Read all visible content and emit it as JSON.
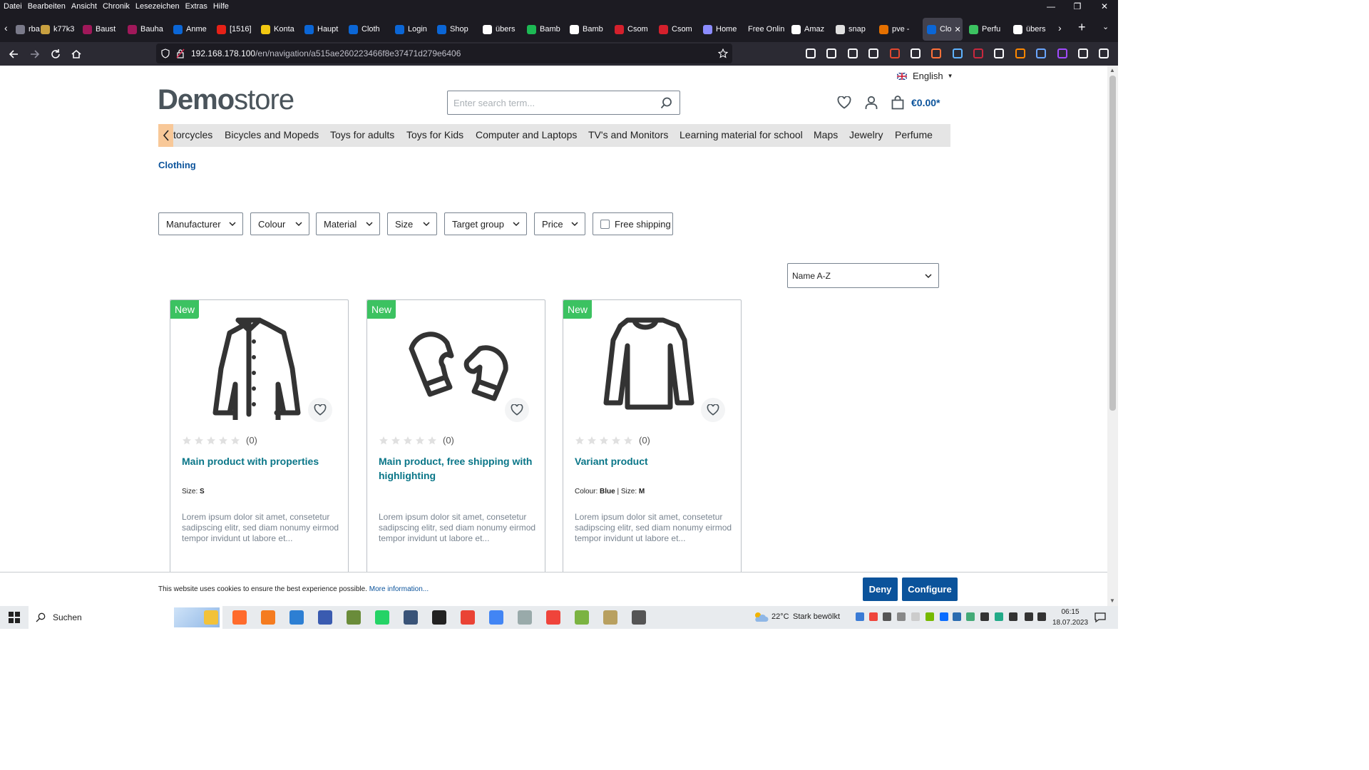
{
  "browser": {
    "menu": [
      "Datei",
      "Bearbeiten",
      "Ansicht",
      "Chronik",
      "Lesezeichen",
      "Extras",
      "Hilfe"
    ],
    "tabs": [
      {
        "label": "rba",
        "color": "#7a7a8a"
      },
      {
        "label": "k77k3",
        "color": "#c8a040"
      },
      {
        "label": "Baust",
        "color": "#a0185a"
      },
      {
        "label": "Bauha",
        "color": "#a0185a"
      },
      {
        "label": "Anme",
        "color": "#0b66d6"
      },
      {
        "label": "[1516]",
        "color": "#e62117"
      },
      {
        "label": "Konta",
        "color": "#f2c811"
      },
      {
        "label": "Haupt",
        "color": "#0b66d6"
      },
      {
        "label": "Cloth",
        "color": "#0b66d6"
      },
      {
        "label": "Login",
        "color": "#0b66d6"
      },
      {
        "label": "Shop",
        "color": "#0b66d6"
      },
      {
        "label": "übers",
        "color": "#ffffff"
      },
      {
        "label": "Bamb",
        "color": "#1db954"
      },
      {
        "label": "Bamb",
        "color": "#ffffff"
      },
      {
        "label": "Csom",
        "color": "#d4202c"
      },
      {
        "label": "Csom",
        "color": "#d4202c"
      },
      {
        "label": "Home",
        "color": "#8c8cff"
      },
      {
        "label": "Free Onlin",
        "color": ""
      },
      {
        "label": "Amaz",
        "color": "#ffffff"
      },
      {
        "label": "snap",
        "color": "#e0e0e0"
      },
      {
        "label": "pve -",
        "color": "#e57000"
      },
      {
        "label": "Clo",
        "color": "#0b66d6"
      },
      {
        "label": "Perfu",
        "color": "#3cc261"
      },
      {
        "label": "übers",
        "color": "#ffffff"
      }
    ],
    "url_host": "192.168.178.100",
    "url_path": "/en/navigation/a515ae260223466f8e37471d279e6406"
  },
  "header": {
    "language": "English",
    "logo_bold": "Demo",
    "logo_light": "store",
    "search_placeholder": "Enter search term...",
    "cart_total": "€0.00*"
  },
  "categories": [
    "torcycles",
    "Bicycles and Mopeds",
    "Toys for adults",
    "Toys for Kids",
    "Computer and Laptops",
    "TV's and Monitors",
    "Learning material for school",
    "Maps",
    "Jewelry",
    "Perfume"
  ],
  "breadcrumb": "Clothing",
  "filters": [
    "Manufacturer",
    "Colour",
    "Material",
    "Size",
    "Target group",
    "Price"
  ],
  "free_shipping_label": "Free shipping",
  "sort_selected": "Name A-Z",
  "products": [
    {
      "badge": "New",
      "reviews": "(0)",
      "title": "Main product with properties",
      "props": [
        {
          "k": "Size:",
          "v": "S"
        }
      ],
      "desc": "Lorem ipsum dolor sit amet, consetetur sadipscing elitr, sed diam nonumy eirmod tempor invidunt ut labore et...",
      "icon": "jacket-icon"
    },
    {
      "badge": "New",
      "reviews": "(0)",
      "title": "Main product, free shipping with highlighting",
      "props": [],
      "desc": "Lorem ipsum dolor sit amet, consetetur sadipscing elitr, sed diam nonumy eirmod tempor invidunt ut labore et...",
      "icon": "mittens-icon"
    },
    {
      "badge": "New",
      "reviews": "(0)",
      "title": "Variant product",
      "props": [
        {
          "k": "Colour:",
          "v": "Blue"
        },
        {
          "k": "Size:",
          "v": "M"
        }
      ],
      "desc": "Lorem ipsum dolor sit amet, consetetur sadipscing elitr, sed diam nonumy eirmod tempor invidunt ut labore et...",
      "icon": "sweater-icon"
    }
  ],
  "cookie": {
    "text": "This website uses cookies to ensure the best experience possible.",
    "link": "More information...",
    "deny": "Deny",
    "configure": "Configure"
  },
  "taskbar": {
    "search": "Suchen",
    "weather_temp": "22°C",
    "weather_text": "Stark bewölkt",
    "time": "06:15",
    "date": "18.07.2023"
  }
}
